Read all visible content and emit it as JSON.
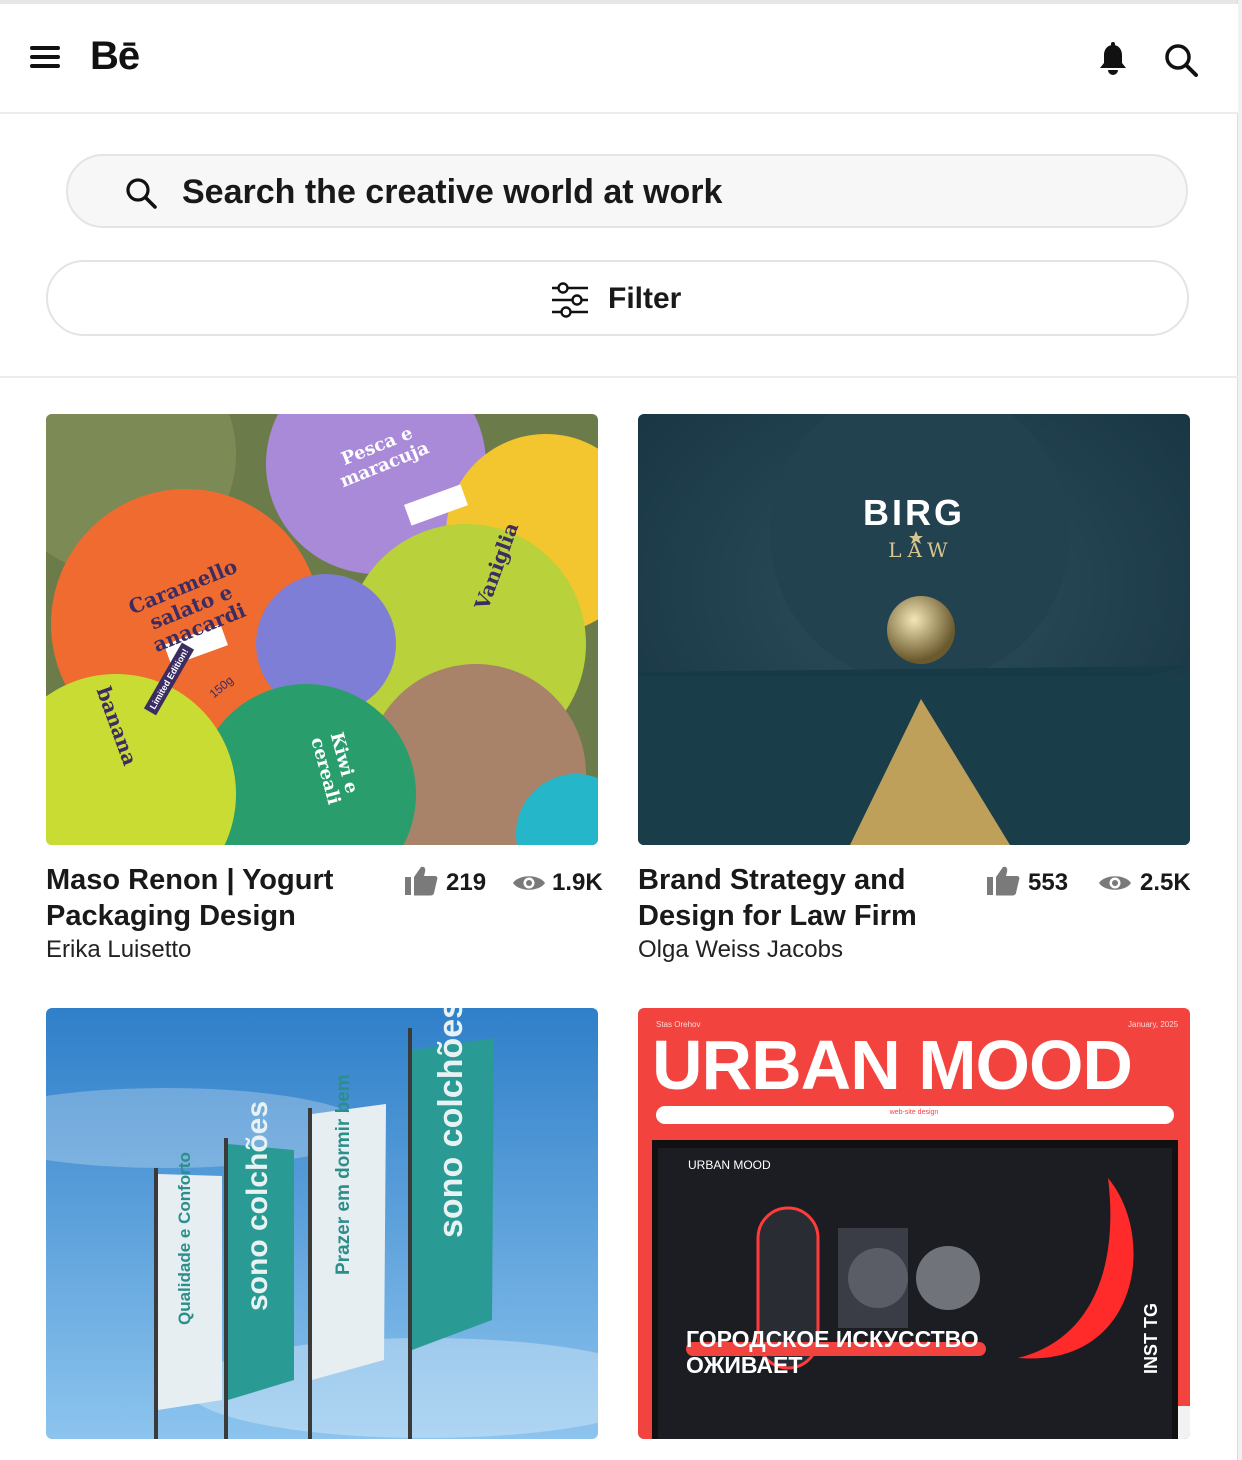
{
  "header": {
    "logo": "Bē"
  },
  "search": {
    "placeholder": "Search the creative world at work"
  },
  "filter": {
    "label": "Filter"
  },
  "projects": [
    {
      "title": "Maso Renon | Yogurt Packaging Design",
      "owner": "Erika Luisetto",
      "appreciations": "219",
      "views": "1.9K",
      "image_labels": [
        "Caramello salato e anacardi",
        "Pesca e maracuja",
        "Vaniglia",
        "Kiwi e cereali",
        "banana",
        "Limited Edition!",
        "150g"
      ]
    },
    {
      "title": "Brand Strategy and Design for Law Firm",
      "owner": "Olga Weiss Jacobs",
      "appreciations": "553",
      "views": "2.5K",
      "image_labels": [
        "BIRG",
        "LAW"
      ]
    },
    {
      "title": "",
      "owner": "",
      "appreciations": "",
      "views": "",
      "image_labels": [
        "Qualidade e Conforto",
        "sono colchões",
        "Prazer em dormir bem",
        "sono colchões"
      ]
    },
    {
      "title": "",
      "owner": "",
      "appreciations": "",
      "views": "",
      "image_labels": [
        "Stas Orehov",
        "January, 2025",
        "URBAN MOOD",
        "web-site design",
        "URBAN MOOD",
        "ГОРОДСКОЕ ИСКУССТВО ОЖИВАЕТ",
        "INST TG"
      ]
    }
  ],
  "colors": {
    "text": "#191919",
    "muted": "#707070",
    "urban_red": "#f2433f"
  },
  "icons": [
    "menu-icon",
    "notification-bell-icon",
    "search-icon",
    "filter-sliders-icon",
    "thumbs-up-icon",
    "eye-icon"
  ]
}
